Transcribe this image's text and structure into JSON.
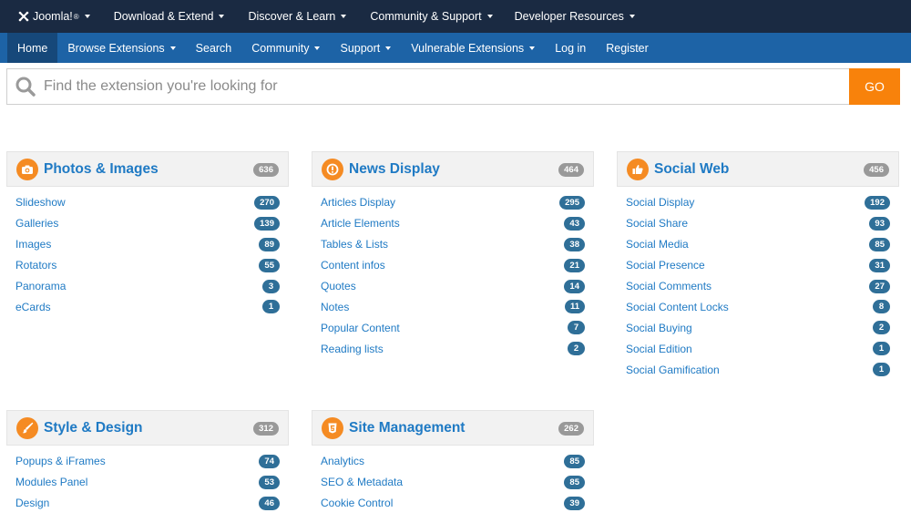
{
  "topnav": {
    "brand": "Joomla!",
    "brand_sup": "®",
    "items": [
      "Download & Extend",
      "Discover & Learn",
      "Community & Support",
      "Developer Resources"
    ]
  },
  "subnav": {
    "items": [
      "Home",
      "Browse Extensions",
      "Search",
      "Community",
      "Support",
      "Vulnerable Extensions",
      "Log in",
      "Register"
    ]
  },
  "search": {
    "placeholder": "Find the extension you're looking for",
    "go_label": "GO"
  },
  "categories": [
    {
      "title": "Photos & Images",
      "total": "636",
      "icon": "camera-icon",
      "items": [
        {
          "label": "Slideshow",
          "count": "270"
        },
        {
          "label": "Galleries",
          "count": "139"
        },
        {
          "label": "Images",
          "count": "89"
        },
        {
          "label": "Rotators",
          "count": "55"
        },
        {
          "label": "Panorama",
          "count": "3"
        },
        {
          "label": "eCards",
          "count": "1"
        }
      ]
    },
    {
      "title": "News Display",
      "total": "464",
      "icon": "exclamation-icon",
      "items": [
        {
          "label": "Articles Display",
          "count": "295"
        },
        {
          "label": "Article Elements",
          "count": "43"
        },
        {
          "label": "Tables & Lists",
          "count": "38"
        },
        {
          "label": "Content infos",
          "count": "21"
        },
        {
          "label": "Quotes",
          "count": "14"
        },
        {
          "label": "Notes",
          "count": "11"
        },
        {
          "label": "Popular Content",
          "count": "7"
        },
        {
          "label": "Reading lists",
          "count": "2"
        }
      ]
    },
    {
      "title": "Social Web",
      "total": "456",
      "icon": "thumbs-up-icon",
      "items": [
        {
          "label": "Social Display",
          "count": "192"
        },
        {
          "label": "Social Share",
          "count": "93"
        },
        {
          "label": "Social Media",
          "count": "85"
        },
        {
          "label": "Social Presence",
          "count": "31"
        },
        {
          "label": "Social Comments",
          "count": "27"
        },
        {
          "label": "Social Content Locks",
          "count": "8"
        },
        {
          "label": "Social Buying",
          "count": "2"
        },
        {
          "label": "Social Edition",
          "count": "1"
        },
        {
          "label": "Social Gamification",
          "count": "1"
        }
      ]
    },
    {
      "title": "Style & Design",
      "total": "312",
      "icon": "paintbrush-icon",
      "items": [
        {
          "label": "Popups & iFrames",
          "count": "74"
        },
        {
          "label": "Modules Panel",
          "count": "53"
        },
        {
          "label": "Design",
          "count": "46"
        }
      ]
    },
    {
      "title": "Site Management",
      "total": "262",
      "icon": "html5-icon",
      "items": [
        {
          "label": "Analytics",
          "count": "85"
        },
        {
          "label": "SEO & Metadata",
          "count": "85"
        },
        {
          "label": "Cookie Control",
          "count": "39"
        }
      ]
    }
  ],
  "colors": {
    "topnav_bg": "#1a2a42",
    "subnav_bg": "#1d63a6",
    "accent_orange": "#f8820b",
    "link_blue": "#1f7ac4",
    "count_badge": "#2f6f98"
  }
}
